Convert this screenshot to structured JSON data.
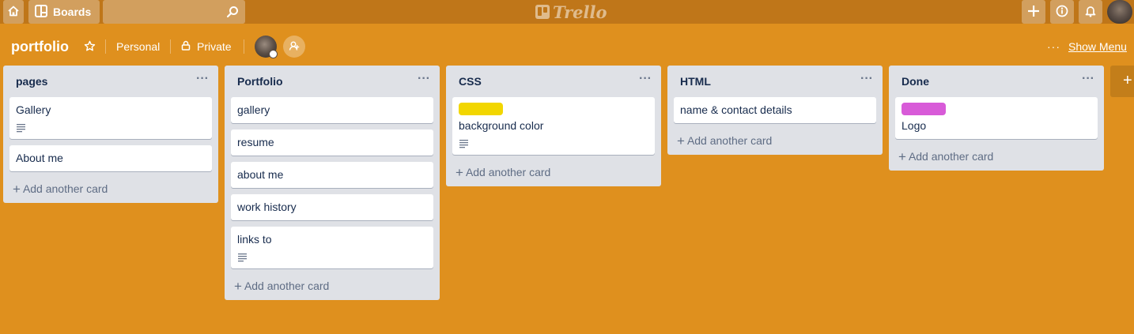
{
  "topbar": {
    "boards_label": "Boards",
    "logo_text": "Trello",
    "search_placeholder": ""
  },
  "board": {
    "title": "portfolio",
    "team": "Personal",
    "visibility": "Private",
    "menu_label": "Show Menu",
    "menu_dots": "···"
  },
  "lists": [
    {
      "title": "pages",
      "cards": [
        {
          "title": "Gallery",
          "label_color": null,
          "has_description": true
        },
        {
          "title": "About me",
          "label_color": null,
          "has_description": false
        }
      ],
      "add_label": "Add another card"
    },
    {
      "title": "Portfolio",
      "cards": [
        {
          "title": "gallery",
          "label_color": null,
          "has_description": false
        },
        {
          "title": "resume",
          "label_color": null,
          "has_description": false
        },
        {
          "title": "about me",
          "label_color": null,
          "has_description": false
        },
        {
          "title": "work history",
          "label_color": null,
          "has_description": false
        },
        {
          "title": "links to",
          "label_color": null,
          "has_description": true
        }
      ],
      "add_label": "Add another card"
    },
    {
      "title": "CSS",
      "cards": [
        {
          "title": "background color",
          "label_color": "#f2d600",
          "has_description": true
        }
      ],
      "add_label": "Add another card"
    },
    {
      "title": "HTML",
      "cards": [
        {
          "title": "name & contact details",
          "label_color": null,
          "has_description": false
        }
      ],
      "add_label": "Add another card"
    },
    {
      "title": "Done",
      "cards": [
        {
          "title": "Logo",
          "label_color": "#d85bd8",
          "has_description": false
        }
      ],
      "add_label": "Add another card"
    }
  ],
  "colors": {
    "board_bg": "#df901e",
    "topbar_bg": "#bf7619",
    "list_bg": "#dfe1e6",
    "card_bg": "#ffffff"
  }
}
